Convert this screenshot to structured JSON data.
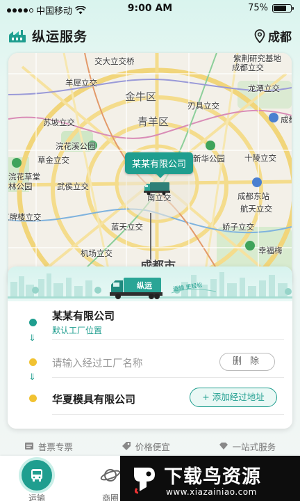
{
  "status_bar": {
    "carrier": "中国移动",
    "time": "9:00 AM",
    "battery": "75%"
  },
  "header": {
    "title": "纵运服务",
    "city": "成都"
  },
  "map": {
    "labels": [
      "交大立交桥",
      "紫荆研究基地",
      "成都立交",
      "羊犀立交",
      "金牛区",
      "龙潭立交",
      "刃具立交",
      "苏坡立交",
      "青羊区",
      "成都",
      "浣花溪公园",
      "新华公园",
      "草金立交",
      "十陵立交",
      "浣花草堂",
      "林公园",
      "武侯立交",
      "成都东站",
      "南立交",
      "航天立交",
      "红牌楼立交",
      "蓝天立交",
      "娇子立交",
      "机场立交",
      "幸福梅",
      "成都市"
    ],
    "pin_label": "某某有限公司"
  },
  "card": {
    "banner_truck_text": "纵运",
    "banner_slogan": "运输 更轻松",
    "start": {
      "title": "某某有限公司",
      "subtitle": "默认工厂位置"
    },
    "via": {
      "placeholder": "请输入经过工厂名称",
      "delete_label": "删 除"
    },
    "end": {
      "title": "华夏模具有限公司",
      "add_label": "添加经过地址"
    }
  },
  "features": [
    "普票专票",
    "价格便宜",
    "一站式服务"
  ],
  "nav": {
    "items": [
      "运输",
      "商圈"
    ]
  },
  "watermark": {
    "title": "下载鸟资源",
    "url": "www.xiazainiao.com"
  },
  "colors": {
    "accent": "#1f9e8f",
    "yellow": "#f1c232"
  }
}
